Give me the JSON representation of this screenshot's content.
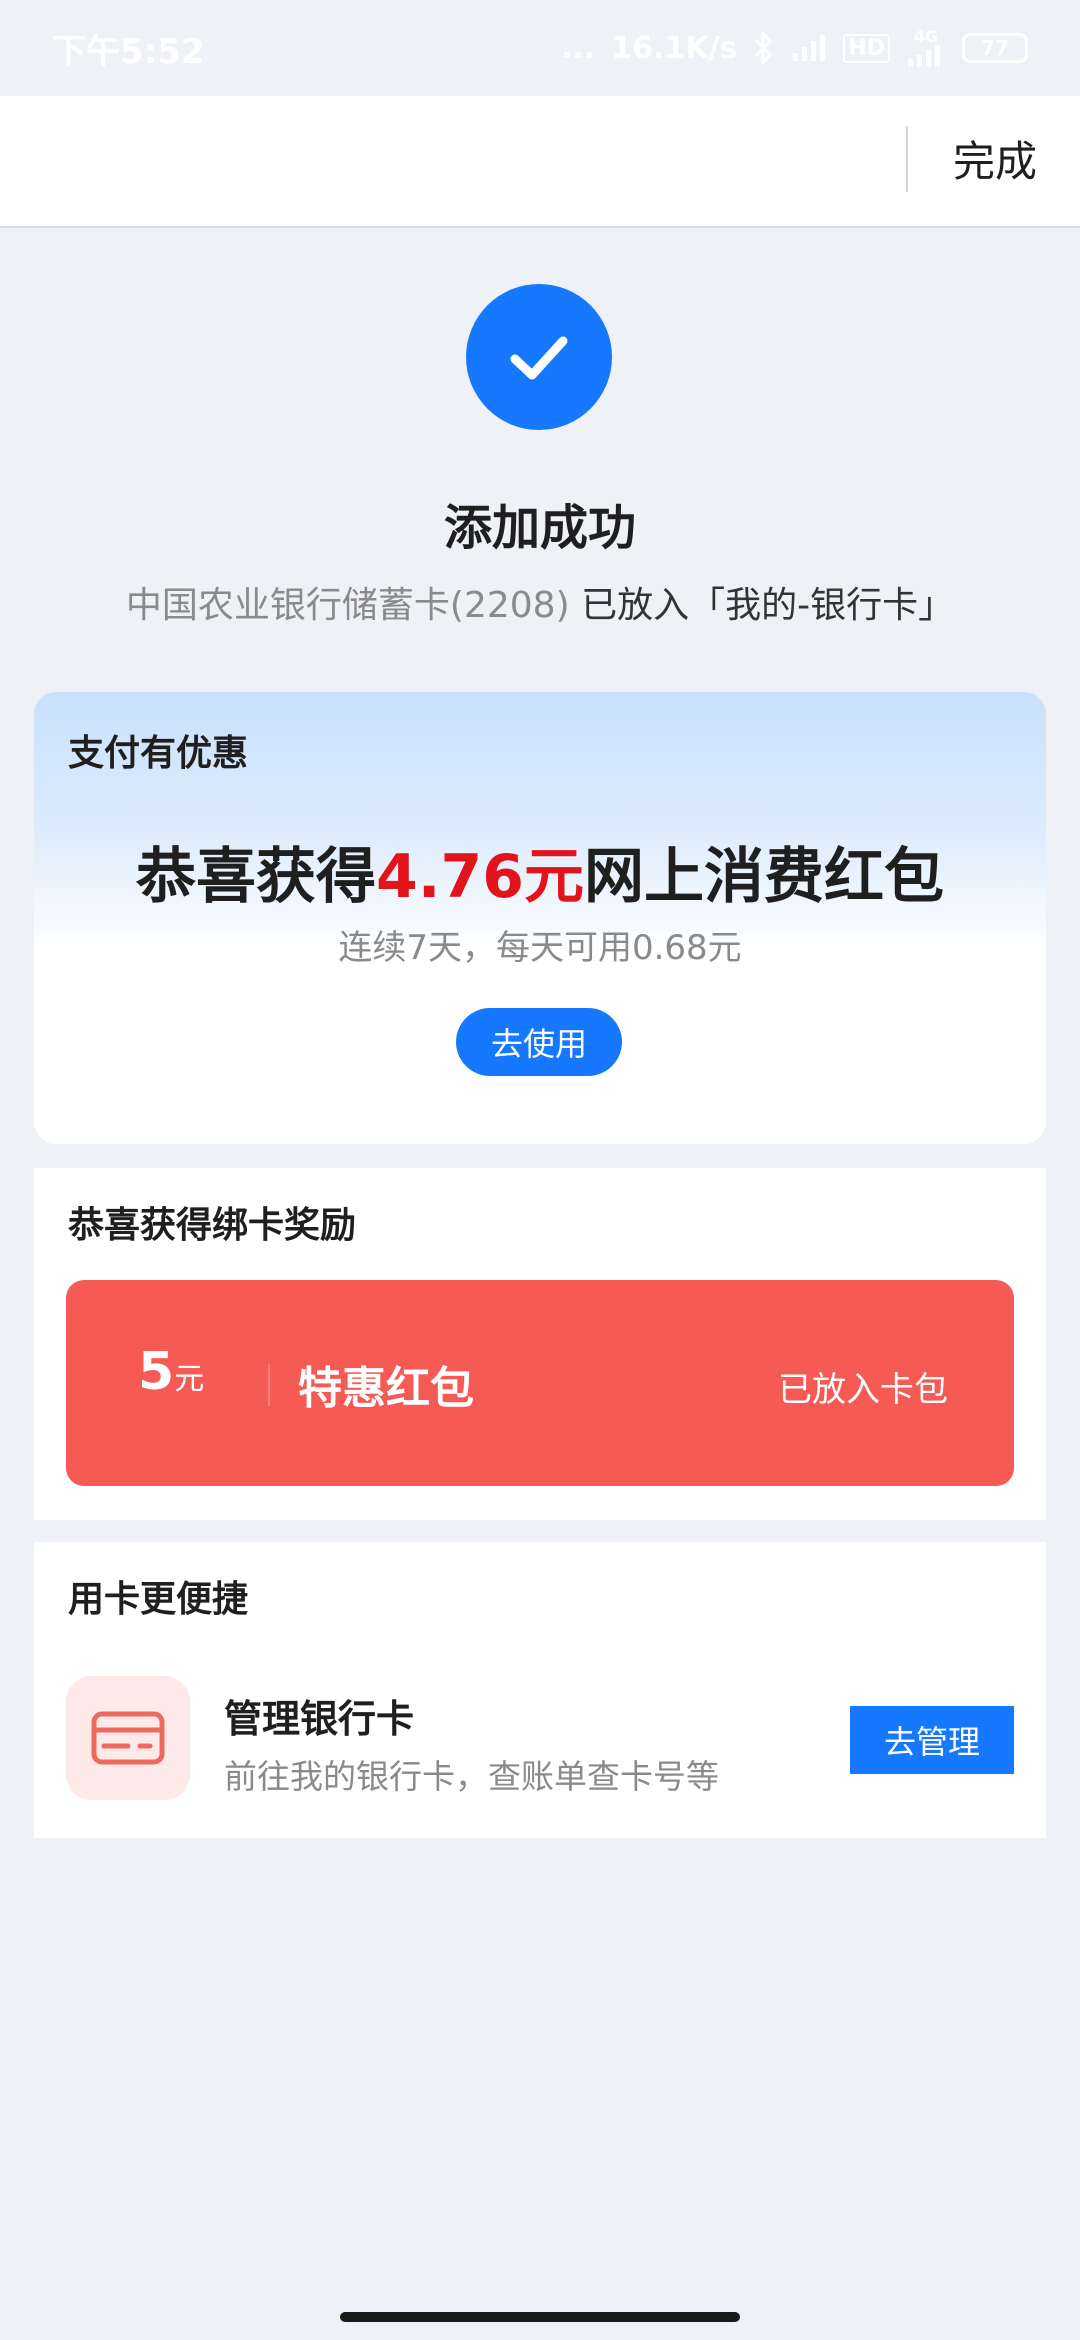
{
  "status_bar": {
    "time": "下午5:52",
    "network_speed": "16.1K/s",
    "network_dots": "...",
    "hd_label": "HD",
    "signal_label": "4G",
    "battery": "77",
    "icons": [
      "bluetooth-icon",
      "signal-icon",
      "hd-icon",
      "4g-signal-icon",
      "battery-icon"
    ]
  },
  "header": {
    "done_label": "完成"
  },
  "success": {
    "icon": "checkmark-icon",
    "title": "添加成功",
    "card_name": "中国农业银行储蓄卡(2208)",
    "placed_text": "已放入「我的-银行卡」"
  },
  "promo": {
    "title": "支付有优惠",
    "headline_prefix": "恭喜获得",
    "headline_amount": "4.76元",
    "headline_suffix": "网上消费红包",
    "description": "连续7天，每天可用0.68元",
    "use_button": "去使用"
  },
  "reward": {
    "title": "恭喜获得绑卡奖励",
    "amount": "5",
    "unit": "元",
    "name": "特惠红包",
    "status": "已放入卡包"
  },
  "manage": {
    "title": "用卡更便捷",
    "item_icon": "bank-card-icon",
    "item_title": "管理银行卡",
    "item_desc": "前往我的银行卡，查账单查卡号等",
    "button": "去管理"
  },
  "colors": {
    "accent": "#1677ff",
    "highlight_red": "#e3131b",
    "reward_bg": "#f65a54",
    "page_bg": "#eef1f6"
  }
}
